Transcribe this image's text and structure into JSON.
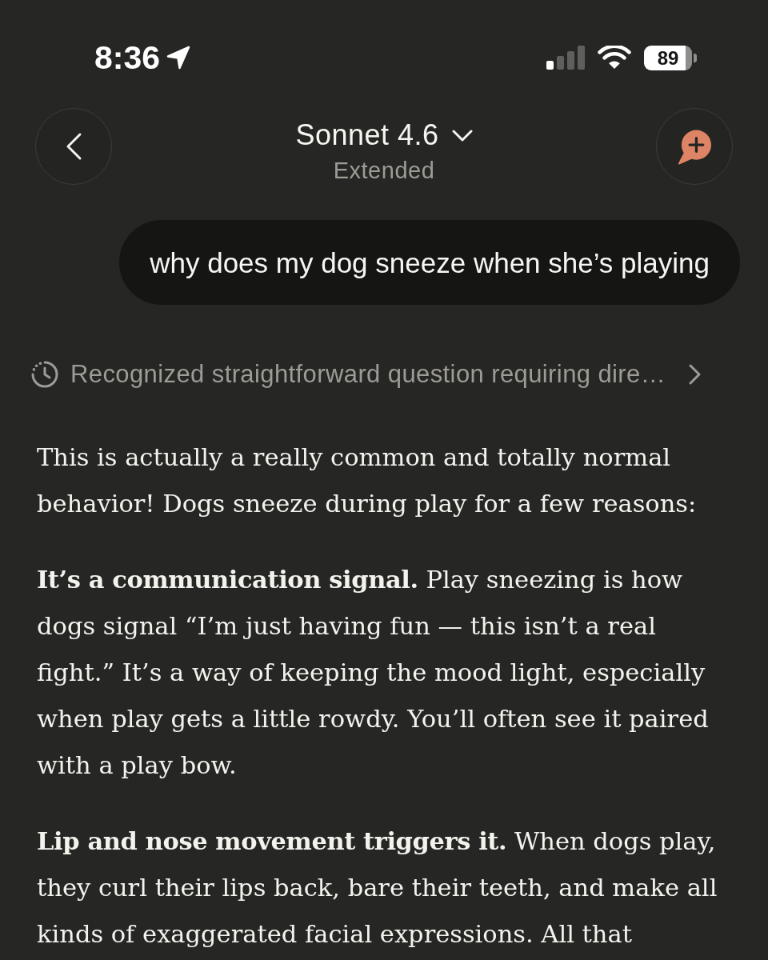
{
  "status_bar": {
    "time": "8:36",
    "battery": "89"
  },
  "header": {
    "title": "Sonnet 4.6",
    "subtitle": "Extended"
  },
  "user_message": {
    "text": "why does my dog sneeze when she’s playing"
  },
  "thinking_summary": {
    "text": "Recognized straightforward question requiring dire…"
  },
  "response": {
    "paragraphs": [
      "This is actually a really common and totally normal behavior! Dogs sneeze during play for a few reasons:",
      "**It’s a communication signal.** Play sneezing is how dogs signal “I’m just having fun — this isn’t a real fight.” It’s a way of keeping the mood light, especially when play gets a little rowdy. You’ll often see it paired with a play bow.",
      "**Lip and nose movement triggers it.** When dogs play, they curl their lips back, bare their teeth, and make all kinds of exaggerated facial expressions. All that"
    ]
  }
}
